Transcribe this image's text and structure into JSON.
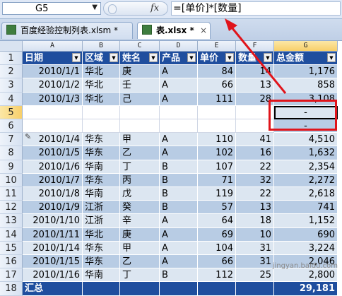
{
  "formula_bar": {
    "name_box": "G5",
    "name_box_dropdown": "▼",
    "fx_label": "fx",
    "formula": "=[单价]*[数量]"
  },
  "tabs": [
    {
      "label": "百度经验控制列表.xlsm *",
      "active": false
    },
    {
      "label": "表.xlsx *",
      "active": true,
      "close": "×"
    }
  ],
  "columns": [
    "A",
    "B",
    "C",
    "D",
    "E",
    "F",
    "G"
  ],
  "selected_column": "G",
  "selected_row": 5,
  "headers": [
    "日期",
    "区域",
    "姓名",
    "产品",
    "单价",
    "数量",
    "总金额"
  ],
  "rows": [
    {
      "row": "1",
      "header": true
    },
    {
      "row": "2",
      "date": "2010/1/1",
      "region": "华北",
      "name": "庚",
      "product": "A",
      "price": "84",
      "qty": "14",
      "total": "1,176"
    },
    {
      "row": "3",
      "date": "2010/1/2",
      "region": "华北",
      "name": "壬",
      "product": "A",
      "price": "66",
      "qty": "13",
      "total": "858"
    },
    {
      "row": "4",
      "date": "2010/1/3",
      "region": "华北",
      "name": "己",
      "product": "A",
      "price": "111",
      "qty": "28",
      "total": "3,108"
    },
    {
      "row": "5",
      "blank": true,
      "total": "-"
    },
    {
      "row": "6",
      "blank": true,
      "total": "-"
    },
    {
      "row": "7",
      "date": "2010/1/4",
      "region": "华东",
      "name": "甲",
      "product": "A",
      "price": "110",
      "qty": "41",
      "total": "4,510"
    },
    {
      "row": "8",
      "date": "2010/1/5",
      "region": "华东",
      "name": "乙",
      "product": "A",
      "price": "102",
      "qty": "16",
      "total": "1,632"
    },
    {
      "row": "9",
      "date": "2010/1/6",
      "region": "华南",
      "name": "丁",
      "product": "B",
      "price": "107",
      "qty": "22",
      "total": "2,354"
    },
    {
      "row": "10",
      "date": "2010/1/7",
      "region": "华东",
      "name": "丙",
      "product": "B",
      "price": "71",
      "qty": "32",
      "total": "2,272"
    },
    {
      "row": "11",
      "date": "2010/1/8",
      "region": "华南",
      "name": "戊",
      "product": "B",
      "price": "119",
      "qty": "22",
      "total": "2,618"
    },
    {
      "row": "12",
      "date": "2010/1/9",
      "region": "江浙",
      "name": "癸",
      "product": "B",
      "price": "57",
      "qty": "13",
      "total": "741"
    },
    {
      "row": "13",
      "date": "2010/1/10",
      "region": "江浙",
      "name": "辛",
      "product": "A",
      "price": "64",
      "qty": "18",
      "total": "1,152"
    },
    {
      "row": "14",
      "date": "2010/1/11",
      "region": "华北",
      "name": "庚",
      "product": "A",
      "price": "69",
      "qty": "10",
      "total": "690"
    },
    {
      "row": "15",
      "date": "2010/1/14",
      "region": "华东",
      "name": "甲",
      "product": "A",
      "price": "104",
      "qty": "31",
      "total": "3,224"
    },
    {
      "row": "16",
      "date": "2010/1/15",
      "region": "华东",
      "name": "乙",
      "product": "A",
      "price": "66",
      "qty": "31",
      "total": "2,046"
    },
    {
      "row": "17",
      "date": "2010/1/16",
      "region": "华南",
      "name": "丁",
      "product": "B",
      "price": "112",
      "qty": "25",
      "total": "2,800"
    },
    {
      "row": "18",
      "total_label": "汇总",
      "grand_total": "29,181"
    }
  ],
  "watermark": "jingyan.baidu.com",
  "colors": {
    "header_blue": "#1f4e9e",
    "band_dark": "#b8cce4",
    "band_light": "#dce6f1",
    "highlight_red": "#e0141b"
  }
}
